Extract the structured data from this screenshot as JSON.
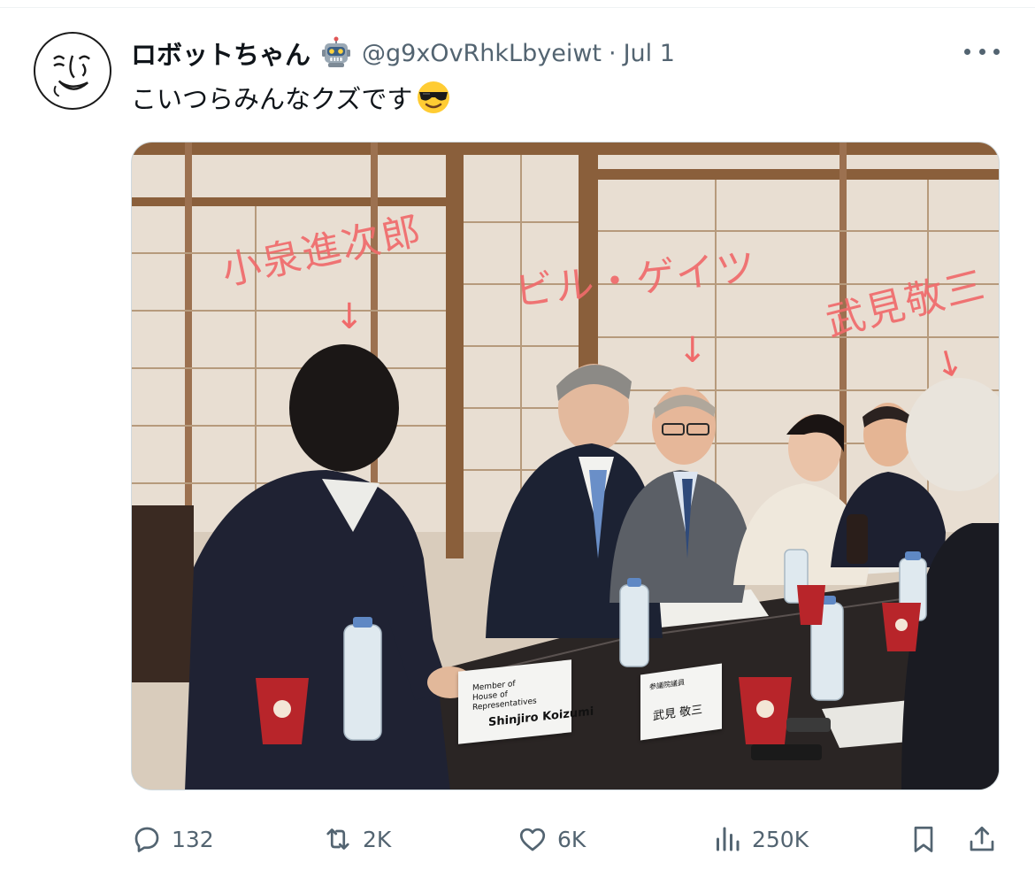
{
  "tweet": {
    "display_name": "ロボットちゃん",
    "display_name_emoji": "robot-face-icon",
    "handle": "@g9xOvRhkLbyeiwt",
    "separator": "·",
    "date": "Jul 1",
    "text": "こいつらみんなクズです",
    "text_emoji": "smiling-face-with-sunglasses-icon"
  },
  "media": {
    "annotations": {
      "koizumi": "小泉進次郎",
      "gates": "ビル・ゲイツ",
      "takemi": "武見敬三",
      "arrow": "↓"
    },
    "nameplates": {
      "koizumi_role": "Member of\nHouse of Representatives",
      "koizumi_name": "Shinjiro Koizumi",
      "takemi_role": "参議院議員",
      "takemi_name": "武見 敬三"
    }
  },
  "actions": {
    "replies": "132",
    "reposts": "2K",
    "likes": "6K",
    "views": "250K"
  },
  "colors": {
    "text_primary": "#0f1419",
    "text_secondary": "#536471",
    "annotation_red": "#f06b6b"
  }
}
